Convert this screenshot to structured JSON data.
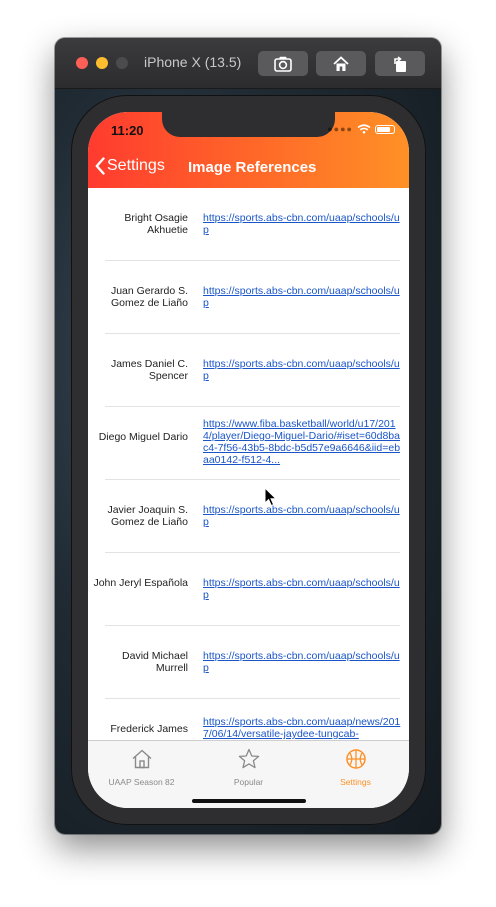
{
  "window": {
    "title": "iPhone X (13.5)",
    "toolbar_icons": [
      "screenshot-icon",
      "home-icon",
      "rotate-icon"
    ]
  },
  "status_bar": {
    "time": "11:20"
  },
  "nav": {
    "back_label": "Settings",
    "title": "Image References"
  },
  "rows": [
    {
      "name": "Bright Osagie Akhuetie",
      "link": "https://sports.abs-cbn.com/uaap/schools/up"
    },
    {
      "name": "Juan Gerardo S. Gomez de Liaño",
      "link": "https://sports.abs-cbn.com/uaap/schools/up"
    },
    {
      "name": "James Daniel C. Spencer",
      "link": "https://sports.abs-cbn.com/uaap/schools/up"
    },
    {
      "name": "Diego Miguel Dario",
      "link": "https://www.fiba.basketball/world/u17/2014/player/Diego-Miguel-Dario/#iset=60d8bac4-7f56-43b5-8bdc-b5d57e9a6646&iid=ebaa0142-f512-4..."
    },
    {
      "name": "Javier Joaquin S. Gomez de Liaño",
      "link": "https://sports.abs-cbn.com/uaap/schools/up"
    },
    {
      "name": "John Jeryl Española",
      "link": "https://sports.abs-cbn.com/uaap/schools/up"
    },
    {
      "name": "David Michael Murrell",
      "link": "https://sports.abs-cbn.com/uaap/schools/up"
    },
    {
      "name": "Frederick James",
      "link": "https://sports.abs-cbn.com/uaap/news/2017/06/14/versatile-jaydee-tungcab-"
    }
  ],
  "tabs": [
    {
      "label": "UAAP Season 82",
      "icon": "home-icon",
      "active": false
    },
    {
      "label": "Popular",
      "icon": "star-icon",
      "active": false
    },
    {
      "label": "Settings",
      "icon": "basketball-icon",
      "active": true
    }
  ],
  "colors": {
    "header_start": "#ff3b2f",
    "header_end": "#ff9126",
    "link": "#1a55c8",
    "active_tab": "#ff9126"
  }
}
